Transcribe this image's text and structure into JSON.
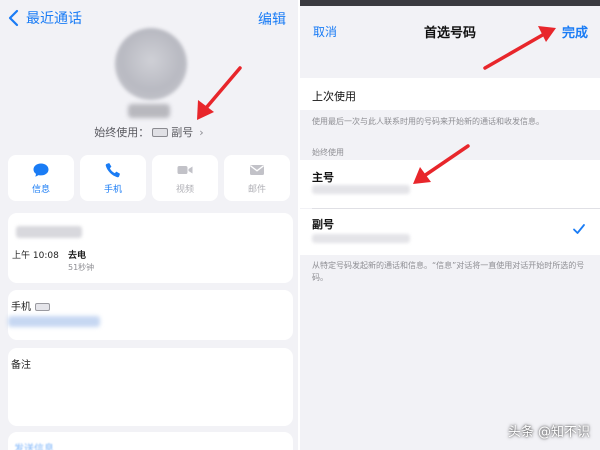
{
  "left": {
    "nav": {
      "back_label": "最近通话",
      "edit_label": "编辑"
    },
    "default_line": {
      "prefix": "始终使用：",
      "value": "副号",
      "chevron": "›"
    },
    "actions": [
      {
        "label": "信息",
        "icon": "message-icon"
      },
      {
        "label": "手机",
        "icon": "phone-icon"
      },
      {
        "label": "视频",
        "icon": "video-icon"
      },
      {
        "label": "邮件",
        "icon": "mail-icon"
      }
    ],
    "call": {
      "time": "上午 10:08",
      "type": "去电",
      "duration": "51秒钟"
    },
    "phone_label": "手机",
    "note_label": "备注",
    "last_row_label": "发送信息"
  },
  "right": {
    "cancel_label": "取消",
    "title": "首选号码",
    "done_label": "完成",
    "last_used_label": "上次使用",
    "last_used_desc": "使用最后一次与此人联系时用的号码来开始新的通话和收发信息。",
    "section_header": "始终使用",
    "main_label": "主号",
    "sub_label": "副号",
    "footer_desc": "从特定号码发起新的通话和信息。“信息”对话将一直使用对话开始时所选的号码。"
  },
  "watermark": "头条 @知不识",
  "colors": {
    "accent": "#1a7cf5",
    "arrow": "#e8262b",
    "background": "#f2f2f6"
  }
}
